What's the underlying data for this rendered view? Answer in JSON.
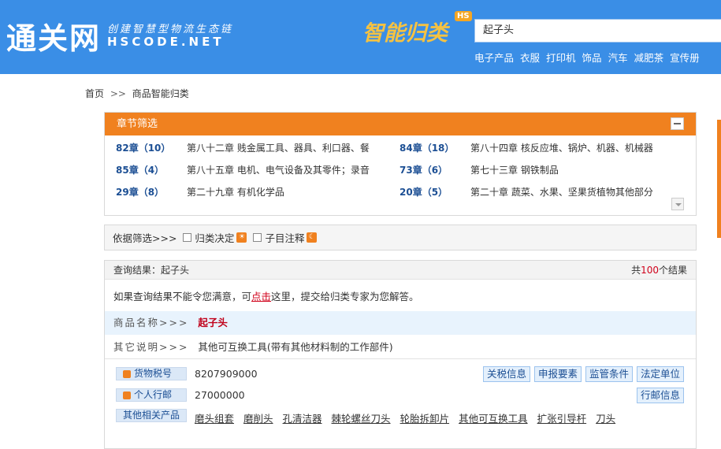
{
  "header": {
    "logo": "通关网",
    "slogan": "创建智慧型物流生态链",
    "domain_text": "HSCODE.NET",
    "brand": "智能归类",
    "brand_badge": "HS",
    "search_value": "起子头",
    "quicklinks": [
      "电子产品",
      "衣服",
      "打印机",
      "饰品",
      "汽车",
      "减肥茶",
      "宣传册"
    ]
  },
  "breadcrumb": {
    "home": "首页",
    "sep": ">>",
    "current": "商品智能归类"
  },
  "chapter_filter": {
    "title": "章节筛选",
    "items": [
      {
        "code": "82章（10）",
        "desc": "第八十二章 贱金属工具、器具、利口器、餐"
      },
      {
        "code": "84章（18）",
        "desc": "第八十四章 核反应堆、锅炉、机器、机械器"
      },
      {
        "code": "85章（4）",
        "desc": "第八十五章 电机、电气设备及其零件；录音"
      },
      {
        "code": "73章（6）",
        "desc": "第七十三章 钢铁制品"
      },
      {
        "code": "29章（8）",
        "desc": "第二十九章 有机化学品"
      },
      {
        "code": "20章（5）",
        "desc": "第二十章 蔬菜、水果、坚果货植物其他部分"
      }
    ]
  },
  "basis_filter": {
    "label": "依据筛选>>>",
    "option1": "归类决定",
    "option2": "子目注释"
  },
  "results": {
    "query_label": "查询结果：起子头",
    "total_prefix": "共",
    "total_num": "100",
    "total_suffix": "个结果",
    "notice_before": "如果查询结果不能令您满意，可",
    "notice_link": "点击",
    "notice_after": "这里，提交给归类专家为您解答。",
    "name_label": "商品名称>>>",
    "name_value": "起子头",
    "other_label": "其它说明>>>",
    "other_value": "其他可互换工具(带有其他材料制的工作部件)",
    "tax_label": "货物税号",
    "tax_value": "8207909000",
    "personal_label": "个人行邮",
    "personal_value": "27000000",
    "related_label": "其他相关产品",
    "buttons": [
      "关税信息",
      "申报要素",
      "监管条件",
      "法定单位"
    ],
    "postal_button": "行邮信息",
    "related": [
      "磨头组套",
      "磨削头",
      "孔清洁器",
      "棘轮螺丝刀头",
      "轮胎拆卸片",
      "其他可互换工具",
      "扩张引导杆",
      "刀头"
    ]
  }
}
